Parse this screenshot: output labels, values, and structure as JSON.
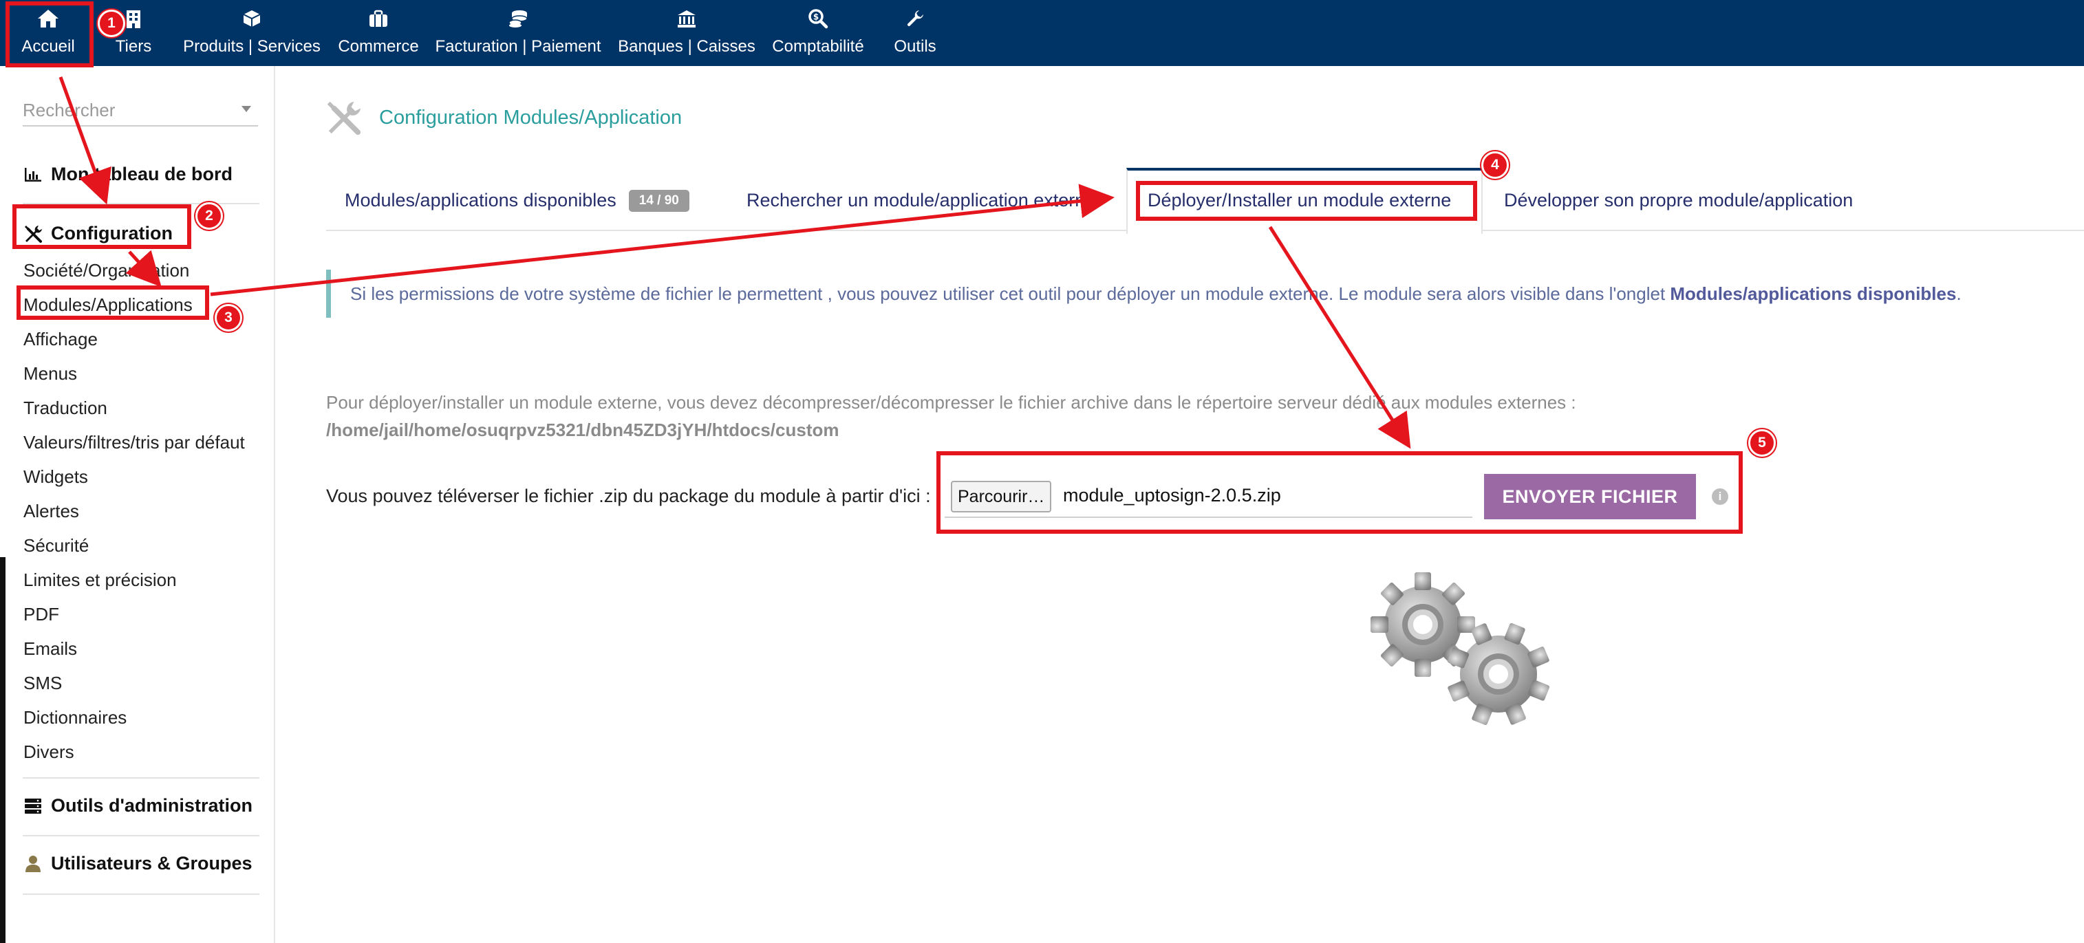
{
  "topnav": [
    {
      "label": "Accueil",
      "icon": "home-icon"
    },
    {
      "label": "Tiers",
      "icon": "building-icon"
    },
    {
      "label": "Produits | Services",
      "icon": "cube-icon"
    },
    {
      "label": "Commerce",
      "icon": "briefcase-icon"
    },
    {
      "label": "Facturation | Paiement",
      "icon": "coins-icon"
    },
    {
      "label": "Banques | Caisses",
      "icon": "bank-icon"
    },
    {
      "label": "Comptabilité",
      "icon": "search-dollar-icon"
    },
    {
      "label": "Outils",
      "icon": "wrench-icon"
    }
  ],
  "sidebar": {
    "search_placeholder": "Rechercher",
    "dashboard_label": "Mon tableau de bord",
    "config_label": "Configuration",
    "items": [
      "Société/Organisation",
      "Modules/Applications",
      "Affichage",
      "Menus",
      "Traduction",
      "Valeurs/filtres/tris par défaut",
      "Widgets",
      "Alertes",
      "Sécurité",
      "Limites et précision",
      "PDF",
      "Emails",
      "SMS",
      "Dictionnaires",
      "Divers"
    ],
    "admin_tools_label": "Outils d'administration",
    "users_groups_label": "Utilisateurs & Groupes"
  },
  "main": {
    "page_title": "Configuration Modules/Application",
    "tabs": [
      {
        "label": "Modules/applications disponibles",
        "badge": "14 / 90"
      },
      {
        "label": "Rechercher un module/application externe"
      },
      {
        "label": "Déployer/Installer un module externe",
        "active": true
      },
      {
        "label": "Développer son propre module/application"
      }
    ],
    "info_text": "Si les permissions de votre système de fichier le permettent , vous pouvez utiliser cet outil pour déployer un module externe. Le module sera alors visible dans l'onglet ",
    "info_bold": "Modules/applications disponibles",
    "info_end": ".",
    "deploy_text": "Pour déployer/installer un module externe, vous devez décompresser/décompresser le fichier archive dans le répertoire serveur dédié aux modules externes :",
    "deploy_path": "/home/jail/home/osuqrpvz5321/dbn45ZD3jYH/htdocs/custom",
    "upload_label": "Vous pouvez téléverser le fichier .zip du package du module à partir d'ici :",
    "browse_label": "Parcourir…",
    "file_name": "module_uptosign-2.0.5.zip",
    "send_label": "ENVOYER FICHIER",
    "info_icon": "i"
  },
  "annotations": [
    "1",
    "2",
    "3",
    "4",
    "5"
  ],
  "colors": {
    "topbar": "#003366",
    "accent_title": "#2a9d9d",
    "tab_text": "#262e6c",
    "send_button": "#9b6aa4",
    "annotation_red": "#e4151c"
  }
}
